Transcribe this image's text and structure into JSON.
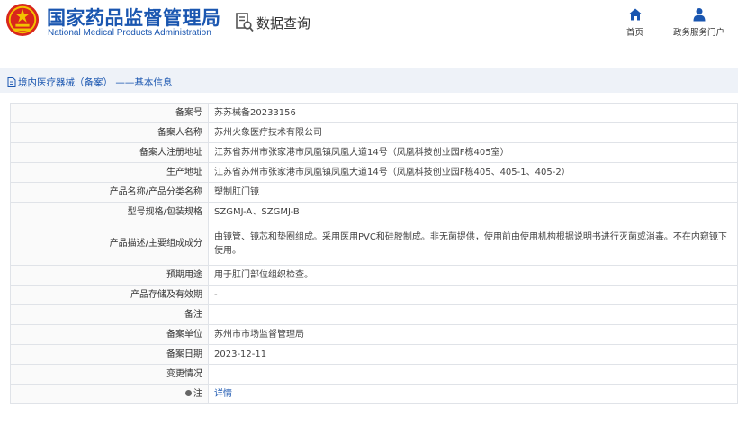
{
  "header": {
    "logo_cn": "国家药品监督管理局",
    "logo_en": "National Medical Products Administration",
    "query_title": "数据查询",
    "nav": [
      {
        "label": "首页",
        "icon": "home-icon"
      },
      {
        "label": "政务服务门户",
        "icon": "user-icon"
      }
    ]
  },
  "breadcrumb": {
    "text": "境内医疗器械（备案） ——基本信息",
    "icon": "document-icon"
  },
  "record": {
    "rows": [
      {
        "label": "备案号",
        "value": "苏苏械备20233156"
      },
      {
        "label": "备案人名称",
        "value": "苏州火象医疗技术有限公司"
      },
      {
        "label": "备案人注册地址",
        "value": "江苏省苏州市张家港市凤凰镇凤凰大道14号（凤凰科技创业园F栋405室）"
      },
      {
        "label": "生产地址",
        "value": "江苏省苏州市张家港市凤凰镇凤凰大道14号（凤凰科技创业园F栋405、405-1、405-2）"
      },
      {
        "label": "产品名称/产品分类名称",
        "value": "塑制肛门镜"
      },
      {
        "label": "型号规格/包装规格",
        "value": "SZGMJ-A、SZGMJ-B"
      },
      {
        "label": "产品描述/主要组成成分",
        "value": "由镜管、镜芯和垫圈组成。采用医用PVC和硅胶制成。非无菌提供，使用前由使用机构根据说明书进行灭菌或消毒。不在内窥镜下使用。"
      },
      {
        "label": "预期用途",
        "value": "用于肛门部位组织检查。"
      },
      {
        "label": "产品存储及有效期",
        "value": "-"
      },
      {
        "label": "备注",
        "value": ""
      },
      {
        "label": "备案单位",
        "value": "苏州市市场监督管理局"
      },
      {
        "label": "备案日期",
        "value": "2023-12-11"
      },
      {
        "label": "变更情况",
        "value": ""
      }
    ],
    "note": {
      "label": "注",
      "value": "详情"
    }
  }
}
